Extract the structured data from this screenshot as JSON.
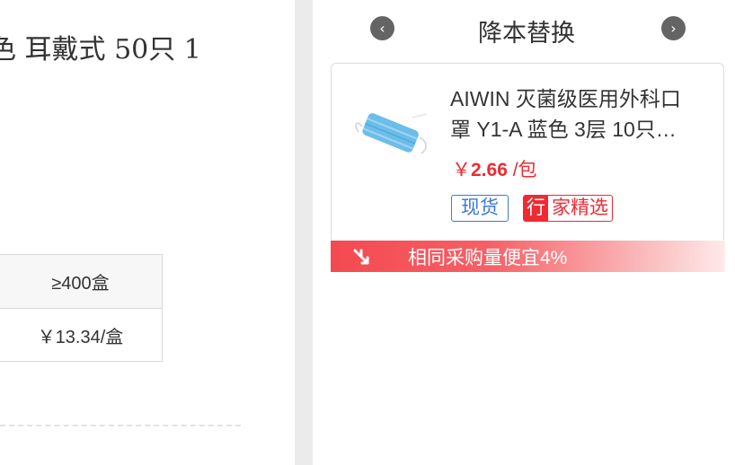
{
  "product": {
    "title_fragment": "色 耳戴式 50只 1"
  },
  "price_table": {
    "quantities": [
      "≥400盒"
    ],
    "prices": [
      "￥13.34/盒"
    ]
  },
  "alternatives": {
    "title": "降本替换",
    "prev_icon": "chevron-left-icon",
    "next_icon": "chevron-right-icon",
    "item": {
      "name_line1": "AIWIN 灭菌级医用外科口",
      "name_line2": "罩 Y1-A 蓝色 3层 10只…",
      "price_symbol": "￥",
      "price_amount": "2.66",
      "price_unit": " /包",
      "tag_stock": "现货",
      "tag_badge": "行",
      "tag_label": "家精选"
    },
    "savings_text": "相同采购量便宜4%"
  },
  "colors": {
    "accent_red": "#ee2a33",
    "tag_blue": "#3a7ad6",
    "nav_gray": "#646464"
  }
}
